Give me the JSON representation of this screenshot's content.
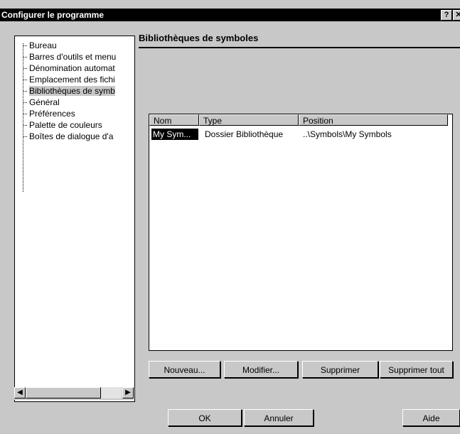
{
  "window": {
    "title": "Configurer le programme",
    "help_glyph": "?",
    "close_glyph": "✕"
  },
  "tree": {
    "items": [
      {
        "label": "Bureau"
      },
      {
        "label": "Barres d'outils et menu"
      },
      {
        "label": "Dénomination automat"
      },
      {
        "label": "Emplacement des fichi"
      },
      {
        "label": "Bibliothèques de symb"
      },
      {
        "label": "Général"
      },
      {
        "label": "Préférences"
      },
      {
        "label": "Palette de couleurs"
      },
      {
        "label": "Boîtes de dialogue d'a"
      }
    ],
    "selected_index": 4,
    "scroll_left": "◀",
    "scroll_right": "▶"
  },
  "panel": {
    "title": "Bibliothèques de symboles"
  },
  "list": {
    "headers": [
      "Nom",
      "Type",
      "Position"
    ],
    "rows": [
      {
        "nom": "My Sym...",
        "type": "Dossier Bibliothèque",
        "position": "..\\Symbols\\My Symbols"
      }
    ]
  },
  "buttons": {
    "nouveau": "Nouveau...",
    "modifier": "Modifier...",
    "supprimer": "Supprimer",
    "supprimer_tout": "Supprimer tout",
    "ok": "OK",
    "annuler": "Annuler",
    "aide": "Aide"
  }
}
